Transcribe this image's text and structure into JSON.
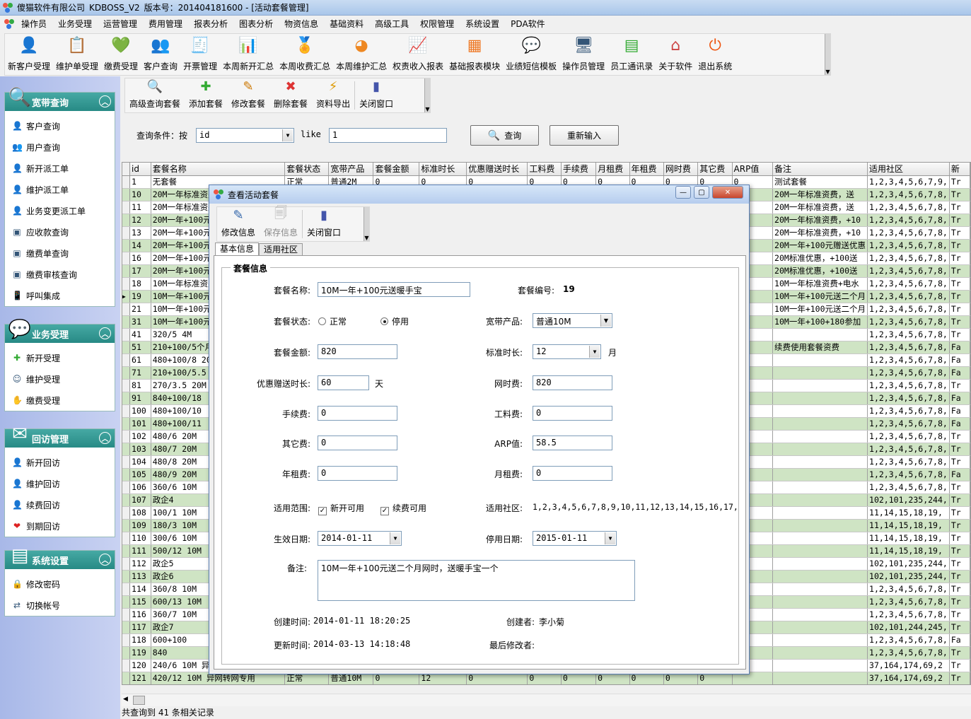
{
  "app": {
    "title_company": "傻猫软件有限公司",
    "title_app": "KDBOSS_V2",
    "title_version": "版本号：201404181600 - [活动套餐管理]"
  },
  "menu": [
    "操作员",
    "业务受理",
    "运营管理",
    "费用管理",
    "报表分析",
    "图表分析",
    "物资信息",
    "基础资料",
    "高级工具",
    "权限管理",
    "系统设置",
    "PDA软件"
  ],
  "toolbar": [
    {
      "label": "新客户受理",
      "icon": "new-customer-icon"
    },
    {
      "label": "维护单受理",
      "icon": "maintenance-form-icon"
    },
    {
      "label": "缴费受理",
      "icon": "payment-heart-icon"
    },
    {
      "label": "客户查询",
      "icon": "customer-search-icon"
    },
    {
      "label": "开票管理",
      "icon": "invoice-icon"
    },
    {
      "label": "本周新开汇总",
      "icon": "bar-chart-icon"
    },
    {
      "label": "本周收费汇总",
      "icon": "medal-icon"
    },
    {
      "label": "本周维护汇总",
      "icon": "pie-chart-icon"
    },
    {
      "label": "权责收入报表",
      "icon": "bar-report-icon"
    },
    {
      "label": "基础报表模块",
      "icon": "report-module-icon"
    },
    {
      "label": "业绩短信模板",
      "icon": "sms-bubble-icon"
    },
    {
      "label": "操作员管理",
      "icon": "monitor-icon"
    },
    {
      "label": "员工通讯录",
      "icon": "address-book-icon"
    },
    {
      "label": "关于软件",
      "icon": "house-icon"
    },
    {
      "label": "退出系统",
      "icon": "power-icon"
    }
  ],
  "sidebar": [
    {
      "title": "宽带查询",
      "items": [
        "客户查询",
        "用户查询",
        "新开派工单",
        "维护派工单",
        "业务变更派工单",
        "应收款查询",
        "缴费单查询",
        "缴费审核查询",
        "呼叫集成"
      ]
    },
    {
      "title": "业务受理",
      "items": [
        "新开受理",
        "维护受理",
        "缴费受理"
      ]
    },
    {
      "title": "回访管理",
      "items": [
        "新开回访",
        "维护回访",
        "续费回访",
        "到期回访"
      ]
    },
    {
      "title": "系统设置",
      "items": [
        "修改密码",
        "切换帐号"
      ]
    }
  ],
  "subtoolbar": [
    "高级查询套餐",
    "添加套餐",
    "修改套餐",
    "删除套餐",
    "资料导出",
    "关闭窗口"
  ],
  "query": {
    "label": "查询条件：按",
    "field": "id",
    "op": "like",
    "value": "1",
    "search_btn": "查询",
    "reset_btn": "重新输入"
  },
  "grid": {
    "columns": [
      "id",
      "套餐名称",
      "套餐状态",
      "宽带产品",
      "套餐金额",
      "标准时长",
      "优惠赠送时长",
      "工料费",
      "手续费",
      "月租费",
      "年租费",
      "网时费",
      "其它费",
      "ARP值",
      "备注",
      "适用社区",
      "新"
    ],
    "rows": [
      [
        "1",
        "无套餐",
        "正常",
        "普通2M",
        "0",
        "0",
        "0",
        "0",
        "0",
        "0",
        "0",
        "0",
        "0",
        "0",
        "测试套餐",
        "1,2,3,4,5,6,7,9,",
        "Tr"
      ],
      [
        "10",
        "20M一年标准资费",
        "",
        "",
        "",
        "",
        "",
        "",
        "",
        "",
        "",
        "",
        "",
        "0",
        "20M一年标准资费，送",
        "1,2,3,4,5,6,7,8,",
        "Tr"
      ],
      [
        "11",
        "20M一年标准资费",
        "",
        "",
        "",
        "",
        "",
        "",
        "",
        "",
        "",
        "",
        "",
        "0",
        "20M一年标准资费，送",
        "1,2,3,4,5,6,7,8,",
        "Tr"
      ],
      [
        "12",
        "20M一年+100元",
        "",
        "",
        "",
        "",
        "",
        "",
        "",
        "",
        "",
        "",
        "",
        "7",
        "20M一年标准资费，+10",
        "1,2,3,4,5,6,7,8,",
        "Tr"
      ],
      [
        "13",
        "20M一年+100元",
        "",
        "",
        "",
        "",
        "",
        "",
        "",
        "",
        "",
        "",
        "",
        "7",
        "20M一年标准资费，+10",
        "1,2,3,4,5,6,7,8,",
        "Tr"
      ],
      [
        "14",
        "20M一年+100元",
        "",
        "",
        "",
        "",
        "",
        "",
        "",
        "",
        "",
        "",
        "",
        "7",
        "20M一年+100元赠送优惠",
        "1,2,3,4,5,6,7,8,",
        "Tr"
      ],
      [
        "16",
        "20M一年+100元",
        "",
        "",
        "",
        "",
        "",
        "",
        "",
        "",
        "",
        "",
        "",
        "7",
        "20M标准优惠，+100送",
        "1,2,3,4,5,6,7,8,",
        "Tr"
      ],
      [
        "17",
        "20M一年+100元",
        "",
        "",
        "",
        "",
        "",
        "",
        "",
        "",
        "",
        "",
        "",
        "7",
        "20M标准优惠，+100送",
        "1,2,3,4,5,6,7,8,",
        "Tr"
      ],
      [
        "18",
        "10M一年标准资费",
        "",
        "",
        "",
        "",
        "",
        "",
        "",
        "",
        "",
        "",
        "",
        "0",
        "10M一年标准资费+电水",
        "1,2,3,4,5,6,7,8,",
        "Tr"
      ],
      [
        "19",
        "10M一年+100元",
        "",
        "",
        "",
        "",
        "",
        "",
        "",
        "",
        "",
        "",
        "",
        "8.5",
        "10M一年+100元送二个月",
        "1,2,3,4,5,6,7,8,",
        "Tr"
      ],
      [
        "21",
        "10M一年+100元",
        "",
        "",
        "",
        "",
        "",
        "",
        "",
        "",
        "",
        "",
        "",
        "8.5",
        "10M一年+100元送二个月",
        "1,2,3,4,5,6,7,8,",
        "Tr"
      ],
      [
        "31",
        "10M一年+100元",
        "",
        "",
        "",
        "",
        "",
        "",
        "",
        "",
        "",
        "",
        "",
        "8.5",
        "10M一年+100+180参加",
        "1,2,3,4,5,6,7,8,",
        "Tr"
      ],
      [
        "41",
        "320/5 4M",
        "",
        "",
        "",
        "",
        "",
        "",
        "",
        "",
        "",
        "",
        "",
        "",
        "",
        "1,2,3,4,5,6,7,8,",
        "Tr"
      ],
      [
        "51",
        "210+100/5个月",
        "",
        "",
        "",
        "",
        "",
        "",
        "",
        "",
        "",
        "",
        "",
        "2",
        "续费使用套餐资费",
        "1,2,3,4,5,6,7,8,",
        "Fa"
      ],
      [
        "61",
        "480+100/8 20M",
        "",
        "",
        "",
        "",
        "",
        "",
        "",
        "",
        "",
        "",
        "",
        "",
        "",
        "1,2,3,4,5,6,7,8,",
        "Fa"
      ],
      [
        "71",
        "210+100/5.5",
        "",
        "",
        "",
        "",
        "",
        "",
        "",
        "",
        "",
        "",
        "",
        "",
        "",
        "1,2,3,4,5,6,7,8,",
        "Fa"
      ],
      [
        "81",
        "270/3.5 20M",
        "",
        "",
        "",
        "",
        "",
        "",
        "",
        "",
        "",
        "",
        "",
        "",
        "",
        "1,2,3,4,5,6,7,8,",
        "Tr"
      ],
      [
        "91",
        "840+100/18",
        "",
        "",
        "",
        "",
        "",
        "",
        "",
        "",
        "",
        "",
        "",
        "",
        "",
        "1,2,3,4,5,6,7,8,",
        "Fa"
      ],
      [
        "100",
        "480+100/10",
        "",
        "",
        "",
        "",
        "",
        "",
        "",
        "",
        "",
        "",
        "",
        "",
        "",
        "1,2,3,4,5,6,7,8,",
        "Fa"
      ],
      [
        "101",
        "480+100/11",
        "",
        "",
        "",
        "",
        "",
        "",
        "",
        "",
        "",
        "",
        "",
        "",
        "",
        "1,2,3,4,5,6,7,8,",
        "Fa"
      ],
      [
        "102",
        "480/6 20M",
        "",
        "",
        "",
        "",
        "",
        "",
        "",
        "",
        "",
        "",
        "",
        "",
        "",
        "1,2,3,4,5,6,7,8,",
        "Tr"
      ],
      [
        "103",
        "480/7 20M",
        "",
        "",
        "",
        "",
        "",
        "",
        "",
        "",
        "",
        "",
        "",
        "",
        "",
        "1,2,3,4,5,6,7,8,",
        "Tr"
      ],
      [
        "104",
        "480/8 20M",
        "",
        "",
        "",
        "",
        "",
        "",
        "",
        "",
        "",
        "",
        "",
        "",
        "",
        "1,2,3,4,5,6,7,8,",
        "Tr"
      ],
      [
        "105",
        "480/9 20M",
        "",
        "",
        "",
        "",
        "",
        "",
        "",
        "",
        "",
        "",
        "",
        "",
        "",
        "1,2,3,4,5,6,7,8,",
        "Fa"
      ],
      [
        "106",
        "360/6 10M",
        "",
        "",
        "",
        "",
        "",
        "",
        "",
        "",
        "",
        "",
        "",
        "",
        "",
        "1,2,3,4,5,6,7,8,",
        "Tr"
      ],
      [
        "107",
        "政企4",
        "",
        "",
        "",
        "",
        "",
        "",
        "",
        "",
        "",
        "",
        "",
        "",
        "",
        "102,101,235,244,",
        "Tr"
      ],
      [
        "108",
        "100/1 10M",
        "",
        "",
        "",
        "",
        "",
        "",
        "",
        "",
        "",
        "",
        "",
        "",
        "",
        "11,14,15,18,19,",
        "Tr"
      ],
      [
        "109",
        "180/3 10M",
        "",
        "",
        "",
        "",
        "",
        "",
        "",
        "",
        "",
        "",
        "",
        "",
        "",
        "11,14,15,18,19,",
        "Tr"
      ],
      [
        "110",
        "300/6 10M",
        "",
        "",
        "",
        "",
        "",
        "",
        "",
        "",
        "",
        "",
        "",
        "",
        "",
        "11,14,15,18,19,",
        "Tr"
      ],
      [
        "111",
        "500/12 10M",
        "",
        "",
        "",
        "",
        "",
        "",
        "",
        "",
        "",
        "",
        "",
        "",
        "",
        "11,14,15,18,19,",
        "Tr"
      ],
      [
        "112",
        "政企5",
        "",
        "",
        "",
        "",
        "",
        "",
        "",
        "",
        "",
        "",
        "",
        "",
        "",
        "102,101,235,244,",
        "Tr"
      ],
      [
        "113",
        "政企6",
        "",
        "",
        "",
        "",
        "",
        "",
        "",
        "",
        "",
        "",
        "",
        "",
        "",
        "102,101,235,244,",
        "Tr"
      ],
      [
        "114",
        "360/8 10M",
        "",
        "",
        "",
        "",
        "",
        "",
        "",
        "",
        "",
        "",
        "",
        "",
        "",
        "1,2,3,4,5,6,7,8,",
        "Tr"
      ],
      [
        "115",
        "600/13 10M",
        "",
        "",
        "",
        "",
        "",
        "",
        "",
        "",
        "",
        "",
        "",
        "",
        "",
        "1,2,3,4,5,6,7,8,",
        "Tr"
      ],
      [
        "116",
        "360/7 10M",
        "",
        "",
        "",
        "",
        "",
        "",
        "",
        "",
        "",
        "",
        "",
        "",
        "",
        "1,2,3,4,5,6,7,8,",
        "Tr"
      ],
      [
        "117",
        "政企7",
        "",
        "",
        "",
        "",
        "",
        "",
        "",
        "",
        "",
        "",
        "",
        "",
        "",
        "102,101,244,245,",
        "Tr"
      ],
      [
        "118",
        "600+100",
        "",
        "",
        "",
        "",
        "",
        "",
        "",
        "",
        "",
        "",
        "",
        "",
        "",
        "1,2,3,4,5,6,7,8,",
        "Fa"
      ],
      [
        "119",
        "840",
        "",
        "",
        "",
        "",
        "",
        "",
        "",
        "",
        "",
        "",
        "",
        "",
        "",
        "1,2,3,4,5,6,7,8,",
        "Tr"
      ],
      [
        "120",
        "240/6 10M 异",
        "",
        "",
        "",
        "",
        "",
        "",
        "",
        "",
        "",
        "",
        "",
        "",
        "",
        "37,164,174,69,2",
        "Tr"
      ],
      [
        "121",
        "420/12 10M 异网转网专用",
        "正常",
        "普通10M",
        "0",
        "12",
        "0",
        "0",
        "0",
        "0",
        "0",
        "0",
        "0",
        "",
        "",
        "37,164,174,69,2",
        "Tr"
      ]
    ],
    "current_row": "19"
  },
  "status": "共查询到 41 条相关记录",
  "dialog": {
    "title": "查看活动套餐",
    "toolbar": [
      "修改信息",
      "保存信息",
      "关闭窗口"
    ],
    "tabs": [
      "基本信息",
      "适用社区"
    ],
    "group_title": "套餐信息",
    "fields": {
      "name_label": "套餐名称:",
      "name": "10M一年+100元送暖手宝",
      "code_label": "套餐编号:",
      "code": "19",
      "state_label": "套餐状态:",
      "state_normal": "正常",
      "state_stopped": "停用",
      "product_label": "宽带产品:",
      "product": "普通10M",
      "amount_label": "套餐金额:",
      "amount": "820",
      "duration_label": "标准时长:",
      "duration": "12",
      "duration_unit": "月",
      "bonus_label": "优惠赠送时长:",
      "bonus": "60",
      "bonus_unit": "天",
      "nettime_label": "网时费:",
      "nettime": "820",
      "fee_label": "手续费:",
      "fee": "0",
      "labor_label": "工料费:",
      "labor": "0",
      "other_label": "其它费:",
      "other": "0",
      "arp_label": "ARP值:",
      "arp": "58.5",
      "annual_label": "年租费:",
      "annual": "0",
      "monthly_label": "月租费:",
      "monthly": "0",
      "scope_label": "适用范围:",
      "scope_new": "新开可用",
      "scope_renew": "续费可用",
      "community_label": "适用社区:",
      "community": "1,2,3,4,5,6,7,8,9,10,11,12,13,14,15,16,17,",
      "start_label": "生效日期:",
      "start": "2014-01-11",
      "stop_label": "停用日期:",
      "stop": "2015-01-11",
      "note_label": "备注:",
      "note": "10M一年+100元送二个月网时，送暖手宝一个",
      "created_label": "创建时间:",
      "created": "2014-01-11 18:20:25",
      "creator_label": "创建者:",
      "creator": "李小菊",
      "updated_label": "更新时间:",
      "updated": "2014-03-13 14:18:48",
      "modifier_label": "最后修改者:",
      "modifier": ""
    }
  }
}
